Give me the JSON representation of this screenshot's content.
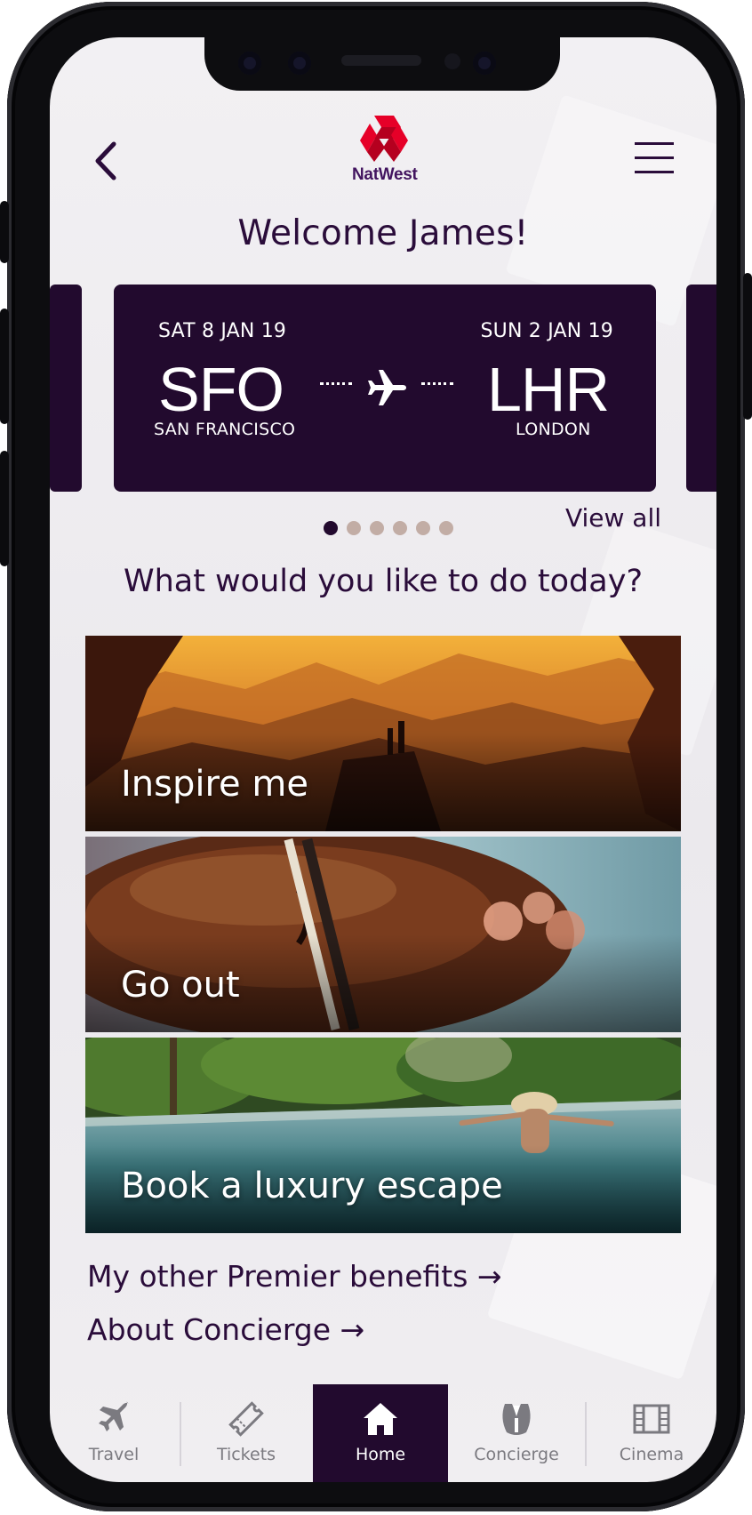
{
  "header": {
    "back_icon": "chevron-left-icon",
    "menu_icon": "hamburger-menu-icon",
    "logo_text": "NatWest",
    "brand_color": "#42145f",
    "logo_red": "#e60028"
  },
  "welcome": "Welcome James!",
  "flight": {
    "depart_date": "SAT 8 JAN 19",
    "depart_code": "SFO",
    "depart_city": "SAN FRANCISCO",
    "arrive_date": "SUN 2 JAN 19",
    "arrive_code": "LHR",
    "arrive_city": "LONDON",
    "card_color": "#220a2e"
  },
  "carousel": {
    "pages": 6,
    "active_index": 0
  },
  "view_all": "View all",
  "prompt": "What would you like to do today?",
  "tiles": [
    {
      "label": "Inspire me"
    },
    {
      "label": "Go out"
    },
    {
      "label": "Book a luxury escape"
    }
  ],
  "links": {
    "premier_benefits": "My other Premier benefits →",
    "about_concierge": "About Concierge →"
  },
  "tabs": [
    {
      "label": "Travel",
      "icon": "airplane-icon"
    },
    {
      "label": "Tickets",
      "icon": "ticket-icon"
    },
    {
      "label": "Home",
      "icon": "home-icon",
      "active": true
    },
    {
      "label": "Concierge",
      "icon": "tuxedo-icon"
    },
    {
      "label": "Cinema",
      "icon": "film-icon"
    }
  ]
}
